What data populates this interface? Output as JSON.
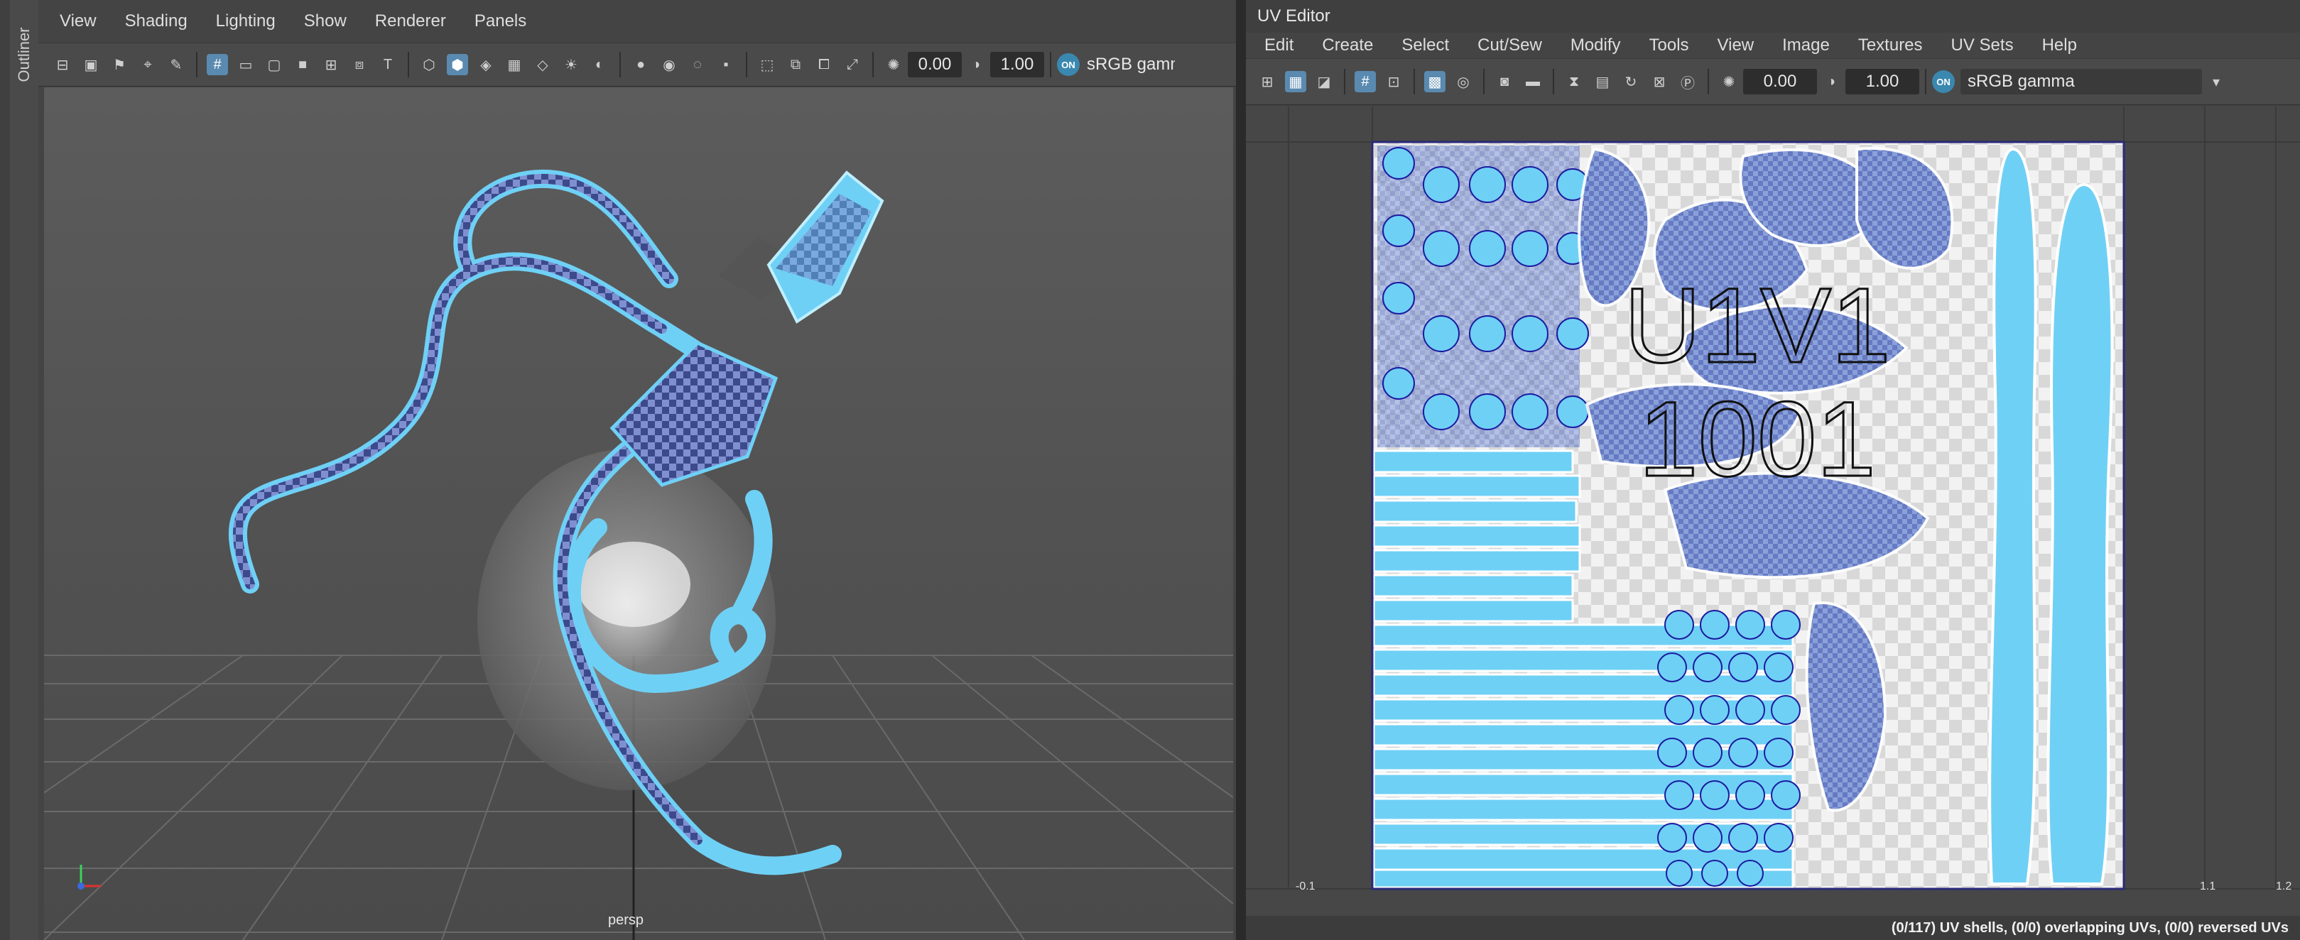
{
  "outliner": {
    "label": "Outliner"
  },
  "viewport": {
    "menu": [
      "View",
      "Shading",
      "Lighting",
      "Show",
      "Renderer",
      "Panels"
    ],
    "toolbar": {
      "exposure": "0.00",
      "gamma": "1.00",
      "color_space_badge": "ON",
      "color_space": "sRGB gamma"
    },
    "camera_label": "persp"
  },
  "uv_editor": {
    "title": "UV Editor",
    "menu": [
      "Edit",
      "Create",
      "Select",
      "Cut/Sew",
      "Modify",
      "Tools",
      "View",
      "Image",
      "Textures",
      "UV Sets",
      "Help"
    ],
    "toolbar": {
      "exposure": "0.00",
      "gamma": "1.00",
      "color_space_badge": "ON",
      "color_space": "sRGB gamma"
    },
    "tile_label_top": "U1V1",
    "tile_label_bottom": "1001",
    "axis_labels": {
      "left_minus": "-0.1",
      "right_1": "1.1",
      "right_2": "1.2"
    },
    "status": "(0/117) UV shells, (0/0) overlapping UVs, (0/0) reversed UVs"
  },
  "colors": {
    "accent": "#5a8ab0",
    "uv_shell": "#6fd0f5",
    "shell_outline": "#1a1aa0",
    "panel": "#444444"
  }
}
